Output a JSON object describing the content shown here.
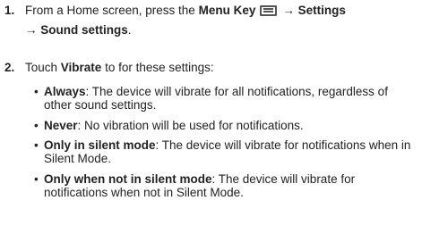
{
  "step1": {
    "number": "1.",
    "text_a": "From a Home screen, press the ",
    "menu_key_label": "Menu Key",
    "menu_key_icon": "menu-key-icon",
    "arrow1": "→",
    "settings_label": "Settings",
    "arrow2": "→",
    "sound_settings_label": "Sound settings",
    "period": "."
  },
  "step2": {
    "number": "2.",
    "touch": "Touch ",
    "vibrate_label": "Vibrate",
    "text_b": " to for these settings:",
    "options": [
      {
        "bullet": "•",
        "term": "Always",
        "desc": ": The device will vibrate for all notifications, regardless of other sound settings."
      },
      {
        "bullet": "•",
        "term": "Never",
        "desc": ": No vibration will be used for notifications."
      },
      {
        "bullet": "•",
        "term": "Only in silent mode",
        "desc": ": The device will vibrate for notifications when in Silent Mode."
      },
      {
        "bullet": "•",
        "term": "Only when not in silent mode",
        "desc": ": The device will vibrate for notifications when not in Silent Mode."
      }
    ]
  }
}
